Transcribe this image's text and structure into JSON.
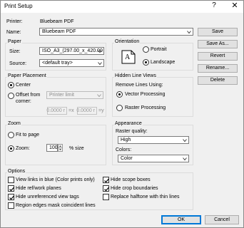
{
  "window": {
    "title": "Print Setup",
    "help_glyph": "?",
    "close_glyph": "✕"
  },
  "printer": {
    "label": "Printer:",
    "value": "Bluebeam PDF"
  },
  "name": {
    "label": "Name:",
    "value": "Bluebeam PDF"
  },
  "buttons": {
    "save": "Save",
    "save_as": "Save As...",
    "revert": "Revert",
    "rename": "Rename...",
    "delete": "Delete",
    "ok": "OK",
    "cancel": "Cancel"
  },
  "paper": {
    "title": "Paper",
    "size_label": "Size:",
    "size_value": "ISO_A3_(297.00_x_420.00",
    "source_label": "Source:",
    "source_value": "<default tray>"
  },
  "orientation": {
    "title": "Orientation",
    "portrait": "Portrait",
    "landscape": "Landscape",
    "selected": "landscape",
    "icon_letter": "A"
  },
  "paper_placement": {
    "title": "Paper Placement",
    "center": "Center",
    "offset": "Offset from corner:",
    "corner_value": "Printer limit",
    "x_value": "0.0000 r",
    "x_suffix": "=x",
    "y_value": "0.0000 r",
    "y_suffix": "=y",
    "selected": "center"
  },
  "hidden_line": {
    "title": "Hidden Line Views",
    "subtitle": "Remove Lines Using:",
    "vector": "Vector Processing",
    "raster": "Raster Processing",
    "selected": "vector"
  },
  "zoom": {
    "title": "Zoom",
    "fit": "Fit to page",
    "zoom": "Zoom:",
    "value": "100",
    "suffix": "% size",
    "selected": "zoom"
  },
  "appearance": {
    "title": "Appearance",
    "raster_label": "Raster quality:",
    "raster_value": "High",
    "colors_label": "Colors:",
    "colors_value": "Color"
  },
  "options": {
    "title": "Options",
    "left": [
      {
        "label": "View links in blue (Color prints only)",
        "checked": false
      },
      {
        "label": "Hide ref/work planes",
        "checked": true
      },
      {
        "label": "Hide unreferenced view tags",
        "checked": true
      },
      {
        "label": "Region edges mask coincident lines",
        "checked": false
      }
    ],
    "right": [
      {
        "label": "Hide scope boxes",
        "checked": true
      },
      {
        "label": "Hide crop boundaries",
        "checked": true
      },
      {
        "label": "Replace halftone with thin lines",
        "checked": false
      }
    ]
  }
}
